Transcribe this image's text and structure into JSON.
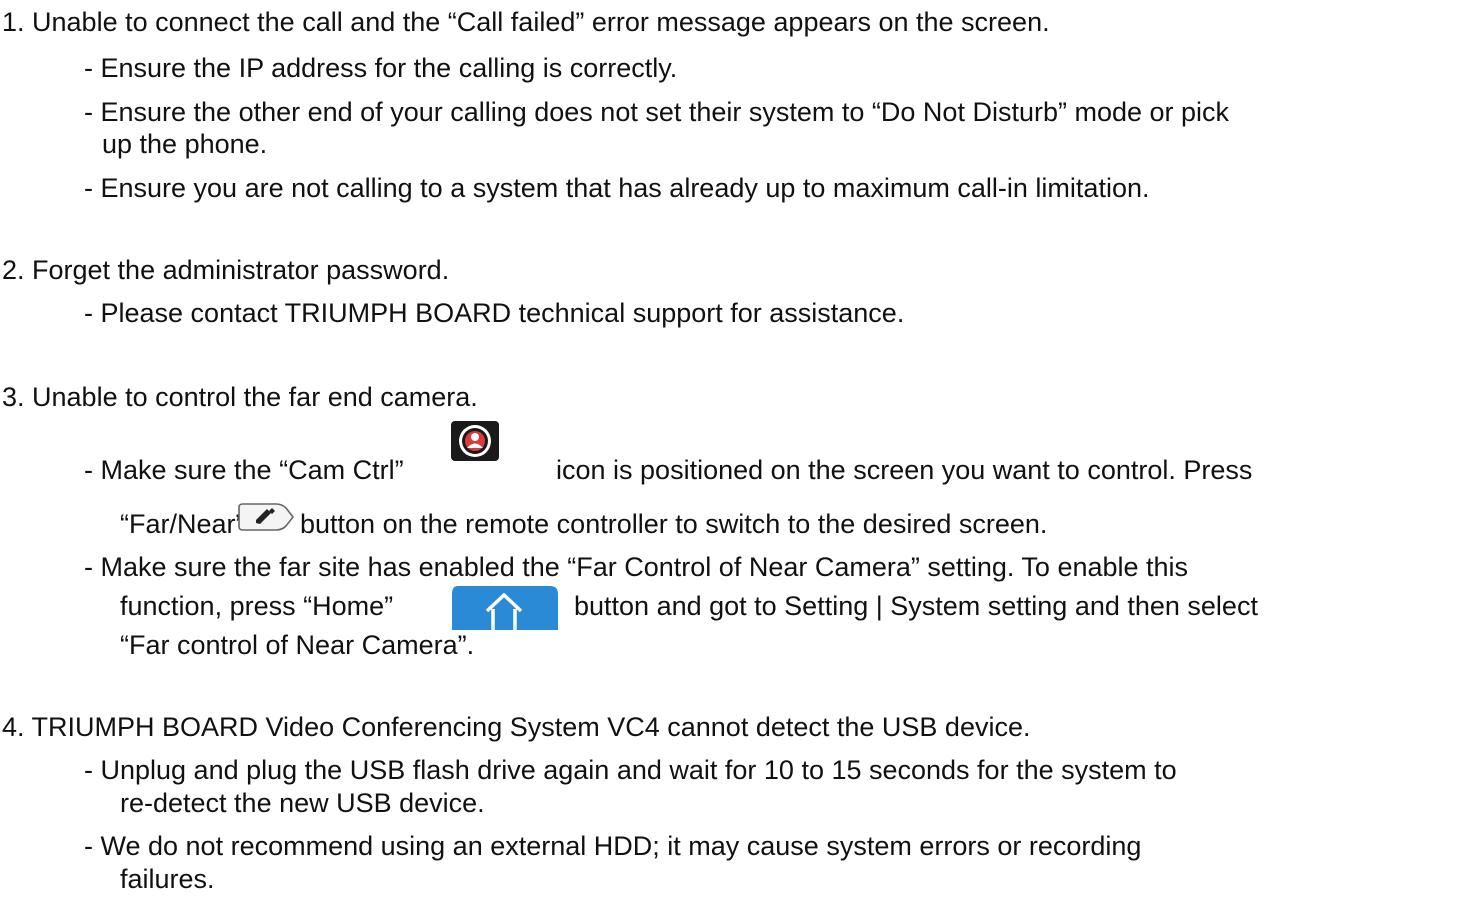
{
  "sections": [
    {
      "heading": "1. Unable to connect the call and the “Call failed” error message appears on the screen.",
      "items": [
        "- Ensure the IP address for the calling is correctly.",
        "- Ensure the other end of your calling does not set their system to “Do Not Disturb” mode or pick",
        "up the phone.",
        "- Ensure you are not calling to a system that has already up to maximum call-in limitation."
      ]
    },
    {
      "heading": "2. Forget the administrator password.",
      "items": [
        "- Please contact TRIUMPH BOARD technical support for assistance."
      ]
    },
    {
      "heading": "3. Unable to control the far end camera.",
      "items": [
        "- Make sure the “Cam Ctrl”",
        "icon is positioned on the screen you want to control. Press",
        "“Far/Near”",
        "button on the remote controller to switch to the desired screen.",
        "- Make sure the far site has enabled the “Far Control of Near Camera” setting. To enable this",
        "function, press “Home”",
        "button and got to Setting  |  System setting and then select",
        "“Far control of Near Camera”."
      ]
    },
    {
      "heading": "4.  TRIUMPH BOARD Video Conferencing System VC4 cannot detect the USB device.",
      "items": [
        "- Unplug and plug the USB flash drive again and wait for 10 to 15 seconds for the system to",
        "re-detect the new USB device.",
        "- We do not recommend using an external HDD; it may cause system errors or recording",
        "failures."
      ]
    }
  ],
  "icons": {
    "cam_ctrl": "cam-ctrl-icon",
    "far_near": "far-near-button-icon",
    "home": "home-button-icon"
  },
  "colors": {
    "text": "#111111",
    "home_button": "#2a8ad6",
    "cam_icon_ring": "#d93a3a"
  }
}
